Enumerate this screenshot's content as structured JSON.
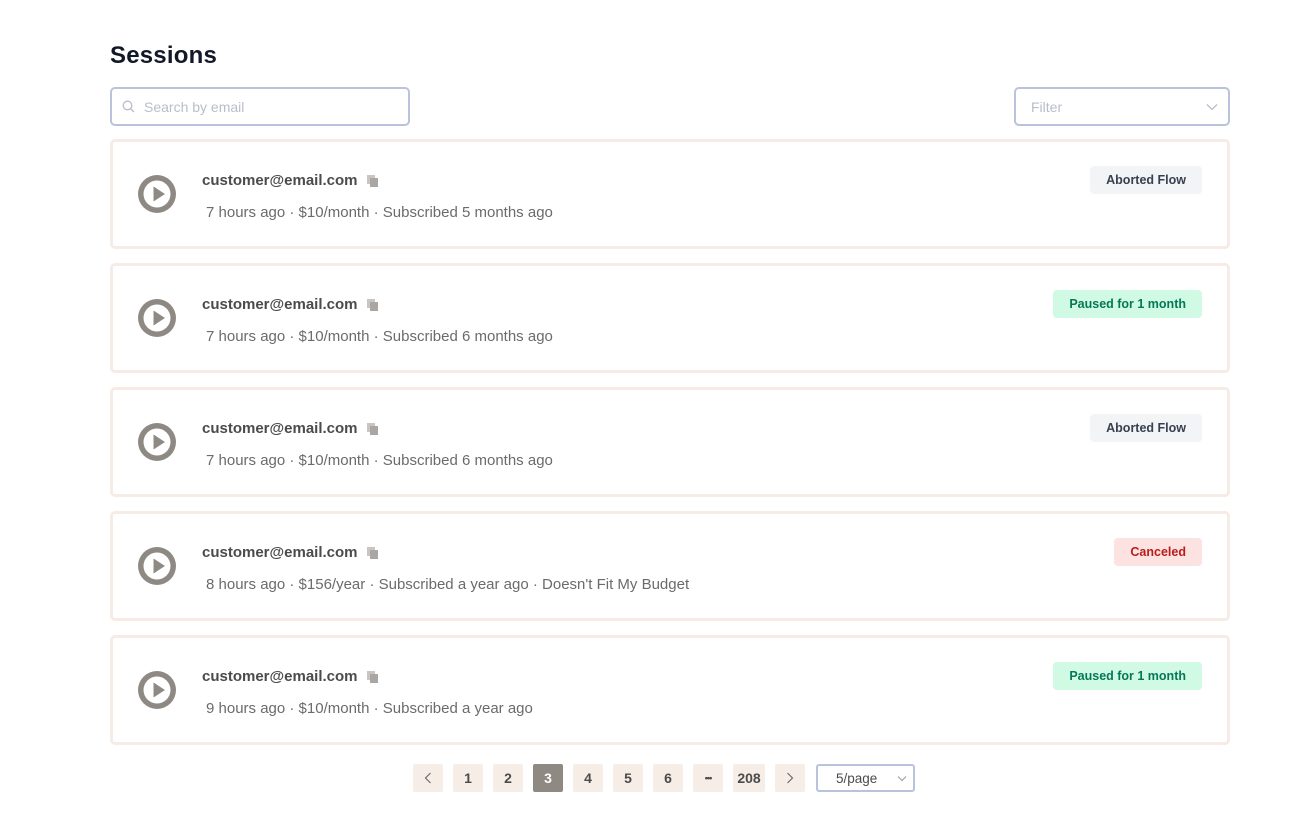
{
  "page": {
    "title": "Sessions"
  },
  "search": {
    "placeholder": "Search by email",
    "value": ""
  },
  "filter": {
    "placeholder": "Filter"
  },
  "sessions": [
    {
      "email": "customer@email.com",
      "meta": "7 hours ago · $10/month · Subscribed 5 months ago",
      "status": "Aborted Flow",
      "status_type": "aborted"
    },
    {
      "email": "customer@email.com",
      "meta": "7 hours ago · $10/month · Subscribed 6 months ago",
      "status": "Paused for 1 month",
      "status_type": "paused"
    },
    {
      "email": "customer@email.com",
      "meta": "7 hours ago · $10/month · Subscribed 6 months ago",
      "status": "Aborted Flow",
      "status_type": "aborted"
    },
    {
      "email": "customer@email.com",
      "meta": "8 hours ago · $156/year · Subscribed a year ago · Doesn't Fit My Budget",
      "status": "Canceled",
      "status_type": "canceled"
    },
    {
      "email": "customer@email.com",
      "meta": "9 hours ago · $10/month · Subscribed a year ago",
      "status": "Paused for 1 month",
      "status_type": "paused"
    }
  ],
  "pagination": {
    "prev_icon": "chevron-left-icon",
    "pages": [
      "1",
      "2",
      "3",
      "4",
      "5",
      "6"
    ],
    "current_page": "3",
    "ellipsis": "•••",
    "last_page": "208",
    "next_icon": "chevron-right-icon",
    "page_size": "5/page"
  },
  "colors": {
    "accent": "#8f8983",
    "card_border": "#f7ebe5",
    "input_border": "#b9c3db",
    "aborted_bg": "#f3f4f6",
    "paused_bg": "#d1fae5",
    "paused_text": "#047857",
    "canceled_bg": "#fde2e2",
    "canceled_text": "#b91c1c"
  }
}
